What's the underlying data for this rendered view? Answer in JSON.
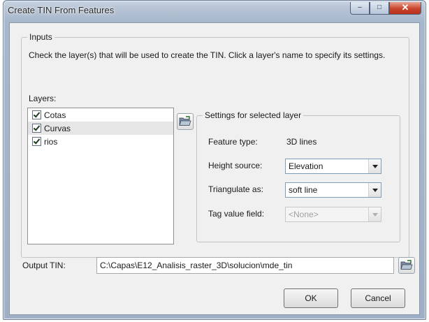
{
  "window": {
    "title": "Create TIN From Features",
    "minimize_glyph": "–",
    "maximize_glyph": "□",
    "close_glyph": "✕"
  },
  "inputs": {
    "group_label": "Inputs",
    "instructions": "Check the layer(s) that will be used to create the TIN.  Click a layer's name to specify its settings.",
    "layers_label": "Layers:",
    "layers": [
      {
        "name": "Cotas",
        "checked": true
      },
      {
        "name": "Curvas",
        "checked": true,
        "selected": true
      },
      {
        "name": "rios",
        "checked": true
      }
    ]
  },
  "settings": {
    "group_label": "Settings for selected layer",
    "feature_type_label": "Feature type:",
    "feature_type_value": "3D lines",
    "height_source_label": "Height source:",
    "height_source_value": "Elevation",
    "triangulate_label": "Triangulate as:",
    "triangulate_value": "soft line",
    "tag_value_label": "Tag value field:",
    "tag_value_value": "<None>"
  },
  "output": {
    "label": "Output TIN:",
    "value": "C:\\Capas\\E12_Analisis_raster_3D\\solucion\\mde_tin"
  },
  "buttons": {
    "ok": "OK",
    "cancel": "Cancel"
  },
  "icons": {
    "open_folder_icon": "open-folder-icon"
  }
}
